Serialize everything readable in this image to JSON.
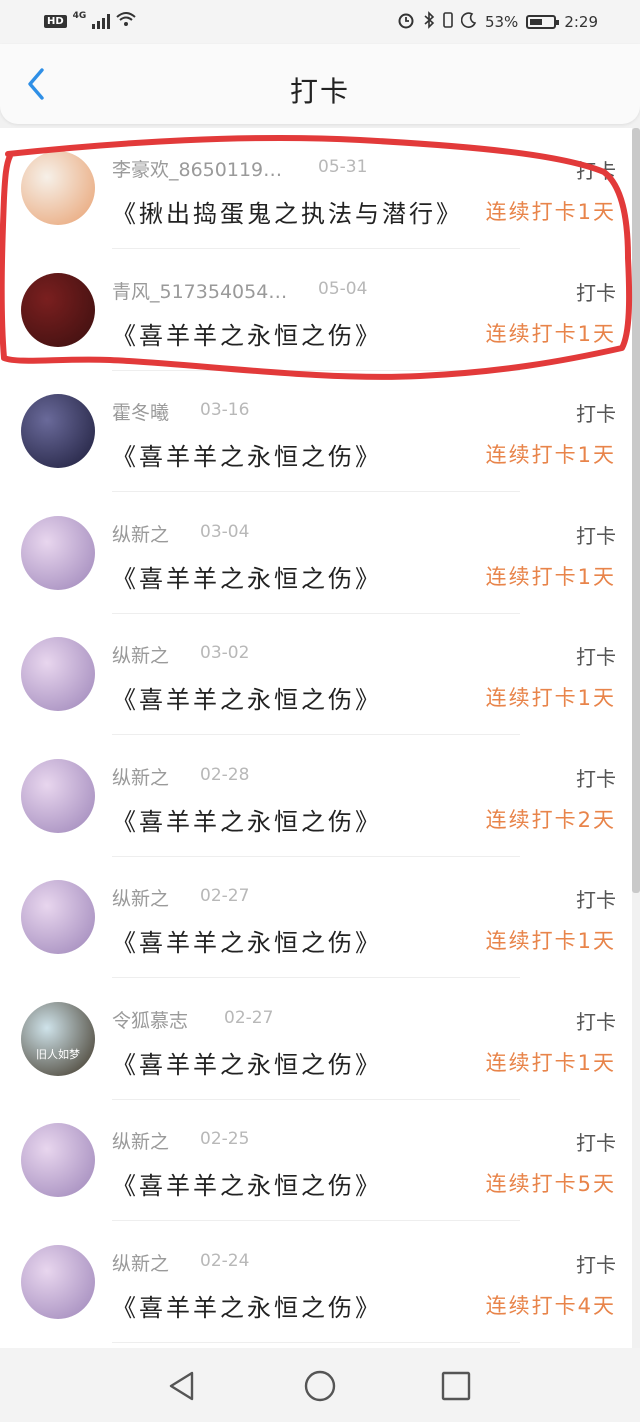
{
  "status_bar": {
    "network_badge": "HD",
    "network_type": "4G",
    "battery_percent": "53%",
    "battery_level": 0.53,
    "time": "2:29"
  },
  "header": {
    "title": "打卡"
  },
  "items": [
    {
      "user": "李豪欢_8650119…",
      "date": "05-31",
      "book": "《揪出捣蛋鬼之执法与潜行》",
      "action": "打卡",
      "streak": "连续打卡1天",
      "avatar_colors": [
        "#f6f0e8",
        "#e8a070"
      ]
    },
    {
      "user": "青风_517354054…",
      "date": "05-04",
      "book": "《喜羊羊之永恒之伤》",
      "action": "打卡",
      "streak": "连续打卡1天",
      "avatar_colors": [
        "#7a1f1f",
        "#3a0f0f"
      ]
    },
    {
      "user": "霍冬曦",
      "date": "03-16",
      "book": "《喜羊羊之永恒之伤》",
      "action": "打卡",
      "streak": "连续打卡1天",
      "avatar_colors": [
        "#6a6a9a",
        "#1c1c3a"
      ]
    },
    {
      "user": "纵新之",
      "date": "03-04",
      "book": "《喜羊羊之永恒之伤》",
      "action": "打卡",
      "streak": "连续打卡1天",
      "avatar_colors": [
        "#e8d6ee",
        "#9c84b8"
      ]
    },
    {
      "user": "纵新之",
      "date": "03-02",
      "book": "《喜羊羊之永恒之伤》",
      "action": "打卡",
      "streak": "连续打卡1天",
      "avatar_colors": [
        "#e8d6ee",
        "#9c84b8"
      ]
    },
    {
      "user": "纵新之",
      "date": "02-28",
      "book": "《喜羊羊之永恒之伤》",
      "action": "打卡",
      "streak": "连续打卡2天",
      "avatar_colors": [
        "#e8d6ee",
        "#9c84b8"
      ]
    },
    {
      "user": "纵新之",
      "date": "02-27",
      "book": "《喜羊羊之永恒之伤》",
      "action": "打卡",
      "streak": "连续打卡1天",
      "avatar_colors": [
        "#e8d6ee",
        "#9c84b8"
      ]
    },
    {
      "user": "令狐慕志",
      "date": "02-27",
      "book": "《喜羊羊之永恒之伤》",
      "action": "打卡",
      "streak": "连续打卡1天",
      "avatar_colors": [
        "#cfe3ea",
        "#3a3020"
      ],
      "avatar_text": "旧人如梦"
    },
    {
      "user": "纵新之",
      "date": "02-25",
      "book": "《喜羊羊之永恒之伤》",
      "action": "打卡",
      "streak": "连续打卡5天",
      "avatar_colors": [
        "#e8d6ee",
        "#9c84b8"
      ]
    },
    {
      "user": "纵新之",
      "date": "02-24",
      "book": "《喜羊羊之永恒之伤》",
      "action": "打卡",
      "streak": "连续打卡4天",
      "avatar_colors": [
        "#e8d6ee",
        "#9c84b8"
      ]
    }
  ],
  "colors": {
    "accent_back": "#2f8fe6",
    "streak": "#e8844a",
    "highlight": "#e23a3a"
  },
  "nav": {
    "back_icon": "triangle-back-icon",
    "home_icon": "circle-home-icon",
    "recents_icon": "square-recents-icon"
  }
}
